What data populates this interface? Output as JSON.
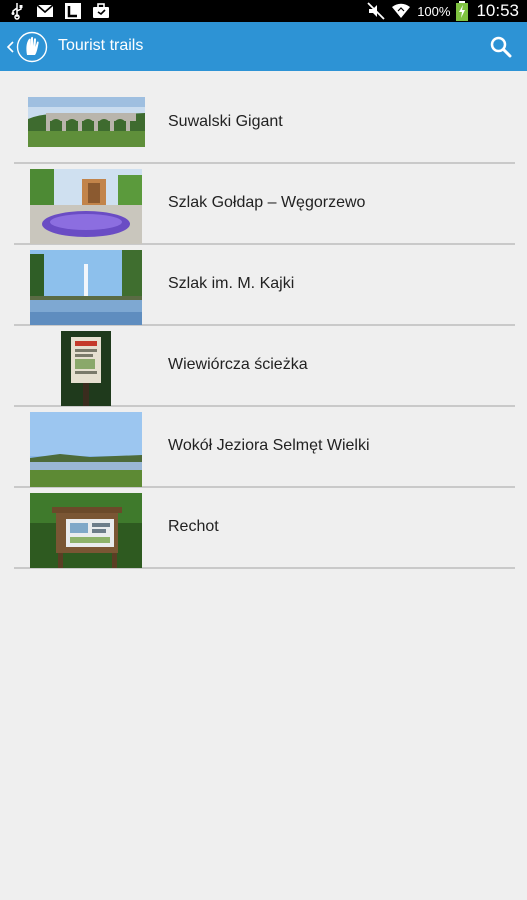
{
  "status_bar": {
    "left_icons": [
      "usb-icon",
      "gmail-icon",
      "app-l-icon",
      "briefcase-icon"
    ],
    "right_icons": [
      "mute-icon",
      "wifi-icon",
      "battery-charging-icon"
    ],
    "battery": "100%",
    "time": "10:53"
  },
  "action_bar": {
    "title": "Tourist trails",
    "colors": {
      "background": "#2d93d5"
    }
  },
  "trails": [
    {
      "name": "Suwalski Gigant",
      "image": "viaduct-photo"
    },
    {
      "name": "Szlak Gołdap – Węgorzewo",
      "image": "flower-bed-photo"
    },
    {
      "name": "Szlak im. M. Kajki",
      "image": "lake-fountain-photo"
    },
    {
      "name": "Wiewiórcza ścieżka",
      "image": "info-board-photo"
    },
    {
      "name": "Wokół Jeziora Selmęt Wielki",
      "image": "lake-shore-photo"
    },
    {
      "name": "Rechot",
      "image": "forest-board-photo"
    }
  ]
}
